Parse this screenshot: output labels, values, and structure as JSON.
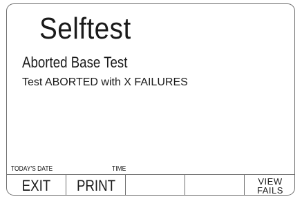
{
  "screen": {
    "title": "Selftest",
    "subtitle": "Aborted Base Test",
    "message": "Test ABORTED with X FAILURES",
    "date_label": "TODAY'S DATE",
    "time_label": "TIME"
  },
  "softkeys": [
    {
      "label": "EXIT"
    },
    {
      "label": "PRINT"
    },
    {
      "label": ""
    },
    {
      "label": ""
    },
    {
      "label": "VIEW\nFAILS"
    }
  ]
}
